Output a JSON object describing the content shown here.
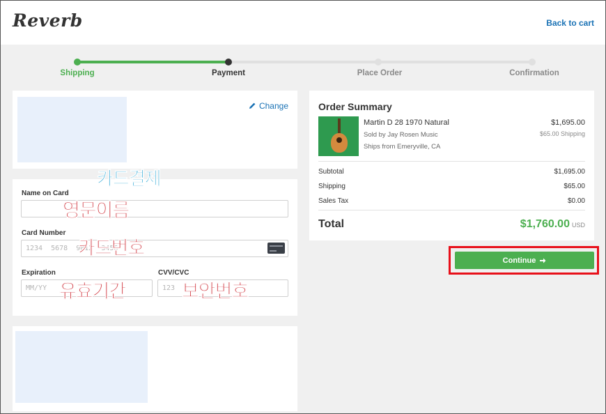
{
  "header": {
    "logo": "Reverb",
    "back_link": "Back to cart"
  },
  "steps": [
    {
      "label": "Shipping",
      "state": "done"
    },
    {
      "label": "Payment",
      "state": "current"
    },
    {
      "label": "Place Order",
      "state": "todo"
    },
    {
      "label": "Confirmation",
      "state": "todo"
    }
  ],
  "shipping_panel": {
    "change_label": "Change"
  },
  "card_form": {
    "name_label": "Name on Card",
    "number_label": "Card Number",
    "number_placeholder": "1234  5678  9012  3456",
    "expiration_label": "Expiration",
    "expiration_placeholder": "MM/YY",
    "cvv_label": "CVV/CVC",
    "cvv_placeholder": "123"
  },
  "annotations": {
    "card_payment": "카드결제",
    "english_name": "영문이름",
    "card_number": "카드번호",
    "expiry": "유효기간",
    "security_code": "보안번호"
  },
  "order_summary": {
    "title": "Order Summary",
    "item": {
      "name": "Martin D 28 1970 Natural",
      "seller": "Sold by Jay Rosen Music",
      "ships_from": "Ships from Emeryville, CA",
      "price": "$1,695.00",
      "shipping": "$65.00 Shipping"
    },
    "rows": [
      {
        "label": "Subtotal",
        "value": "$1,695.00"
      },
      {
        "label": "Shipping",
        "value": "$65.00"
      },
      {
        "label": "Sales Tax",
        "value": "$0.00"
      }
    ],
    "total_label": "Total",
    "total_value": "$1,760.00",
    "total_currency": "USD"
  },
  "continue_button": {
    "label": "Continue"
  },
  "colors": {
    "accent_green": "#4caf50",
    "link_blue": "#1a72b5",
    "highlight_red": "#e8101a"
  }
}
